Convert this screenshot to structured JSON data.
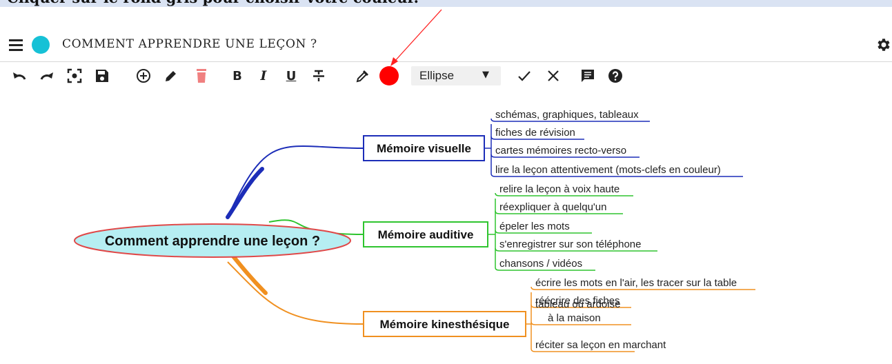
{
  "banner": {
    "text": "Cliquer sur le rond gris pour choisir votre couleur."
  },
  "header": {
    "title": "COMMENT APPRENDRE UNE LEÇON ?",
    "title_color": "#16c1d6"
  },
  "toolbar": {
    "bold_label": "B",
    "italic_label": "I",
    "underline_label": "U",
    "current_color": "#ff0000",
    "shape_select": {
      "value": "Ellipse"
    },
    "icons": [
      "undo-icon",
      "redo-icon",
      "center-icon",
      "save-icon",
      "add-node-icon",
      "edit-icon",
      "delete-icon",
      "bold-icon",
      "italic-icon",
      "underline-icon",
      "strikethrough-icon",
      "eyedropper-icon",
      "color-picker",
      "confirm-icon",
      "cancel-icon",
      "comment-icon",
      "help-icon"
    ]
  },
  "annotation": {
    "arrow_color": "#ff2020"
  },
  "mindmap": {
    "root": {
      "label": "Comment apprendre une leçon ?",
      "fill": "#b6eef2",
      "stroke": "#e04848"
    },
    "branches": [
      {
        "label": "Mémoire visuelle",
        "color": "#1c2db8",
        "children": [
          "schémas, graphiques, tableaux",
          "fiches de révision",
          "cartes mémoires recto-verso",
          "lire la leçon attentivement (mots-clefs en couleur)"
        ]
      },
      {
        "label": "Mémoire auditive",
        "color": "#2ec42e",
        "children": [
          "relire la leçon à voix haute",
          "réexpliquer à quelqu'un",
          "épeler les mots",
          "s'enregistrer sur son téléphone",
          "chansons / vidéos"
        ]
      },
      {
        "label": "Mémoire kinesthésique",
        "color": "#f09020",
        "children": [
          "écrire les mots en l'air, les tracer sur la table",
          "réécrire des fiches",
          "tableau ou ardoise\n    à la maison",
          "réciter sa leçon en marchant"
        ]
      }
    ]
  }
}
